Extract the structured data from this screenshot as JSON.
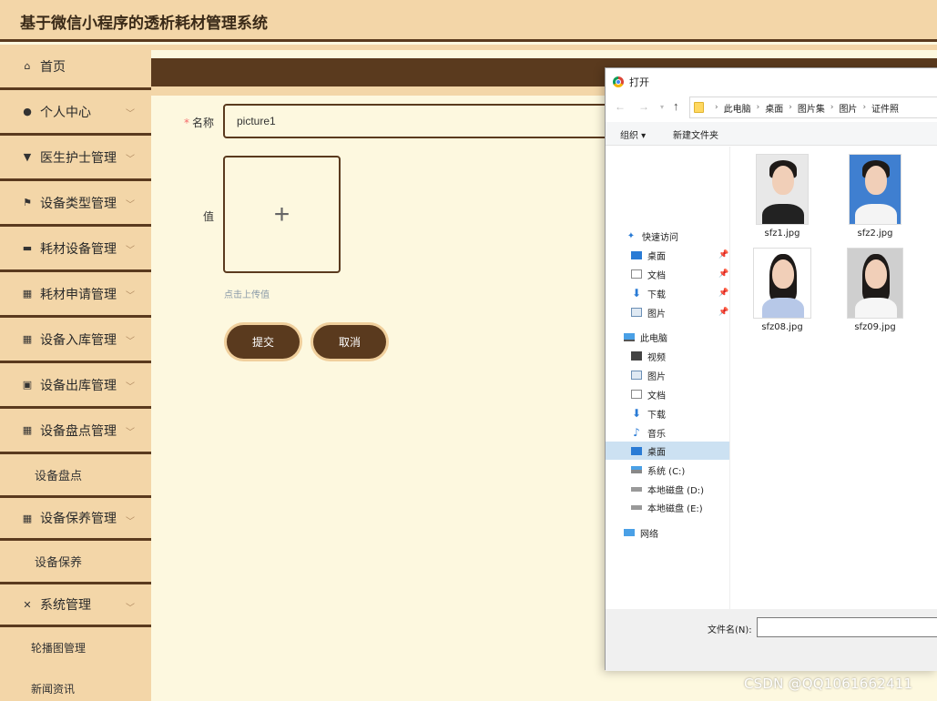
{
  "app": {
    "title": "基于微信小程序的透析耗材管理系统"
  },
  "sidebar": {
    "items": [
      {
        "label": "首页",
        "icon": "home-icon",
        "glyph": "⌂",
        "has_children": false
      },
      {
        "label": "个人中心",
        "icon": "user-icon",
        "glyph": "●",
        "has_children": true
      },
      {
        "label": "医生护士管理",
        "icon": "nurse-icon",
        "glyph": "▼",
        "has_children": true
      },
      {
        "label": "设备类型管理",
        "icon": "flag-icon",
        "glyph": "⚑",
        "has_children": true
      },
      {
        "label": "耗材设备管理",
        "icon": "chat-icon",
        "glyph": "▬",
        "has_children": true
      },
      {
        "label": "耗材申请管理",
        "icon": "grid-icon",
        "glyph": "▦",
        "has_children": true
      },
      {
        "label": "设备入库管理",
        "icon": "grid-icon",
        "glyph": "▦",
        "has_children": true
      },
      {
        "label": "设备出库管理",
        "icon": "clipboard-icon",
        "glyph": "▣",
        "has_children": true
      },
      {
        "label": "设备盘点管理",
        "icon": "grid-icon",
        "glyph": "▦",
        "has_children": true
      }
    ],
    "sub_inventory": "设备盘点",
    "maintenance": {
      "label": "设备保养管理",
      "icon": "grid-icon",
      "glyph": "▦"
    },
    "sub_maintenance": "设备保养",
    "system": {
      "label": "系统管理",
      "icon": "ticket-icon",
      "glyph": "✕"
    },
    "sub_system": [
      "轮播图管理",
      "新闻资讯"
    ]
  },
  "form": {
    "name_label": "名称",
    "name_value": "picture1",
    "value_label": "值",
    "upload_plus": "+",
    "upload_tip": "点击上传值",
    "submit": "提交",
    "cancel": "取消"
  },
  "dialog": {
    "title": "打开",
    "breadcrumb": [
      "此电脑",
      "桌面",
      "图片集",
      "图片",
      "证件照"
    ],
    "toolbar": {
      "organize": "组织 ▾",
      "new_folder": "新建文件夹"
    },
    "nav": {
      "quick_access": "快速访问",
      "quick": [
        "桌面",
        "文档",
        "下载",
        "图片"
      ],
      "this_pc": "此电脑",
      "pc": [
        "视频",
        "图片",
        "文档",
        "下载",
        "音乐",
        "桌面"
      ],
      "drives": [
        "系统 (C:)",
        "本地磁盘 (D:)",
        "本地磁盘 (E:)"
      ],
      "network": "网络"
    },
    "files": [
      "sfz1.jpg",
      "sfz2.jpg",
      "sfz08.jpg",
      "sfz09.jpg"
    ],
    "filename_label": "文件名(N):"
  },
  "watermark": "CSDN @QQ1061662411",
  "colors": {
    "accent": "#5a3a1e",
    "sidebar_bg": "#f3d6a8",
    "content_bg": "#fdf8df"
  }
}
